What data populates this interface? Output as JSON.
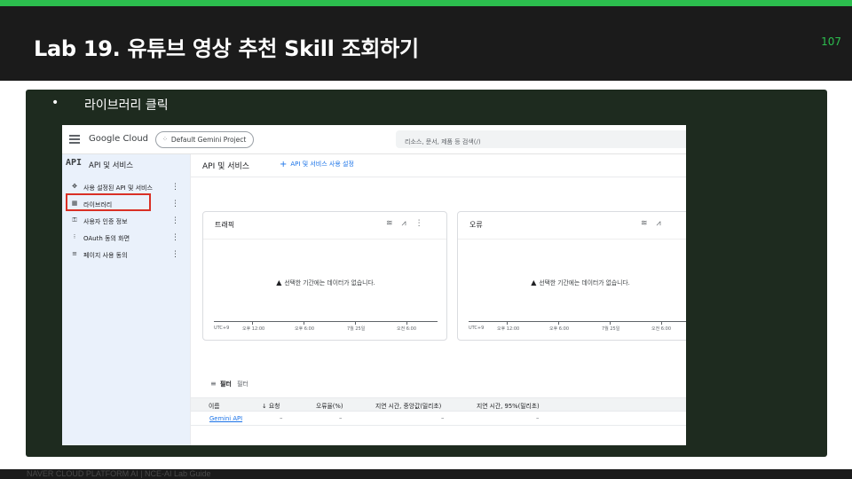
{
  "slide": {
    "title": "Lab 19. 유튜브 영상 추천 Skill 조회하기",
    "page_number": "107",
    "bullet_marker": "•",
    "bullet_text": "라이브러리 클릭",
    "footer": "NAVER CLOUD PLATFORM AI  |  NCE-AI Lab Guide",
    "accent_color": "#2cbe4e"
  },
  "console": {
    "logo": "Google Cloud",
    "project": "Default Gemini Project",
    "search_placeholder": "리소스, 문서, 제품 등 검색(/)",
    "sidebar": {
      "badge": "API",
      "title": "API 및 서비스",
      "items": [
        {
          "icon": "✥",
          "label": "사용 설정된 API 및 서비스"
        },
        {
          "icon": "▦",
          "label": "라이브러리"
        },
        {
          "icon": "⚿",
          "label": "사용자 인증 정보"
        },
        {
          "icon": "⁝",
          "label": "OAuth 동의 화면"
        },
        {
          "icon": "≡",
          "label": "페이지 사용 동의"
        }
      ],
      "highlight_color": "#d93025"
    },
    "main": {
      "title": "API 및 서비스",
      "enable_link": "API 및 서비스 사용 설정",
      "cards": [
        {
          "title": "트래픽",
          "no_data": "선택한 기간에는 데이터가 없습니다.",
          "ticks": [
            "UTC+9",
            "오후 12:00",
            "오후 6:00",
            "7월 25일",
            "오전 6:00"
          ]
        },
        {
          "title": "오류",
          "no_data": "선택한 기간에는 데이터가 없습니다.",
          "ticks": [
            "UTC+9",
            "오후 12:00",
            "오후 6:00",
            "7월 25일",
            "오전 6:00"
          ]
        }
      ],
      "filter": {
        "label": "필터",
        "placeholder": "필터"
      },
      "table": {
        "headers": [
          "이름",
          "요청",
          "오류율(%)",
          "지연 시간, 중앙값(밀리초)",
          "지연 시간, 95%(밀리초)"
        ],
        "rows": [
          {
            "name": "Gemini API",
            "requests": "–",
            "errors": "–",
            "median": "–",
            "p95": "–"
          }
        ]
      }
    }
  }
}
